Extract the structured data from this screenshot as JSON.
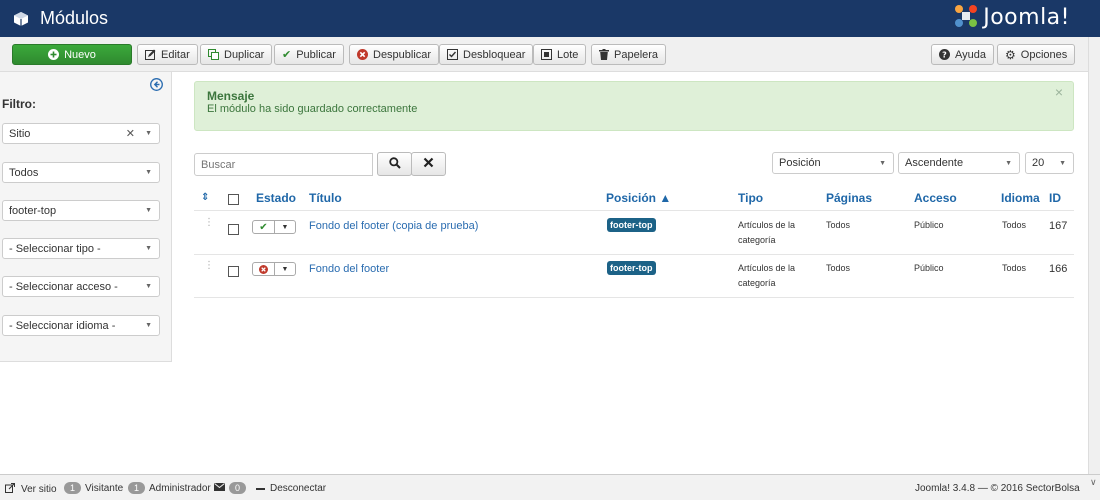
{
  "header": {
    "title": "Módulos",
    "brand": "Joomla!"
  },
  "toolbar": {
    "new": "Nuevo",
    "edit": "Editar",
    "duplicate": "Duplicar",
    "publish": "Publicar",
    "unpublish": "Despublicar",
    "unlock": "Desbloquear",
    "batch": "Lote",
    "trash": "Papelera",
    "help": "Ayuda",
    "options": "Opciones"
  },
  "sidebar": {
    "filter_label": "Filtro:",
    "site": "Sitio",
    "state": "Todos",
    "position": "footer-top",
    "type": "- Seleccionar tipo -",
    "access": "- Seleccionar acceso -",
    "language": "- Seleccionar idioma -"
  },
  "alert": {
    "heading": "Mensaje",
    "message": "El módulo ha sido guardado correctamente"
  },
  "search": {
    "placeholder": "Buscar"
  },
  "list_controls": {
    "order_by": "Posición",
    "direction": "Ascendente",
    "limit": "20"
  },
  "table": {
    "headers": {
      "status": "Estado",
      "title": "Título",
      "position": "Posición ▲",
      "type": "Tipo",
      "pages": "Páginas",
      "access": "Acceso",
      "language": "Idioma",
      "id": "ID"
    },
    "rows": [
      {
        "title": "Fondo del footer (copia de prueba)",
        "position": "footer-top",
        "type_line1": "Artículos de la",
        "type_line2": "categoría",
        "pages": "Todos",
        "access": "Público",
        "language": "Todos",
        "id": "167",
        "published": true
      },
      {
        "title": "Fondo del footer",
        "position": "footer-top",
        "type_line1": "Artículos de la",
        "type_line2": "categoría",
        "pages": "Todos",
        "access": "Público",
        "language": "Todos",
        "id": "166",
        "published": false
      }
    ]
  },
  "footer": {
    "view_site": "Ver sitio",
    "visitors_count": "1",
    "visitors_label": "Visitante",
    "admins_count": "1",
    "admins_label": "Administrador",
    "messages_count": "0",
    "logout": "Desconectar",
    "version": "Joomla! 3.4.8 — © 2016 SectorBolsa"
  },
  "colors": {
    "header_bg": "#1a3867",
    "success": "#2f8a2f",
    "link": "#2a6cb0",
    "badge": "#1c6287"
  }
}
